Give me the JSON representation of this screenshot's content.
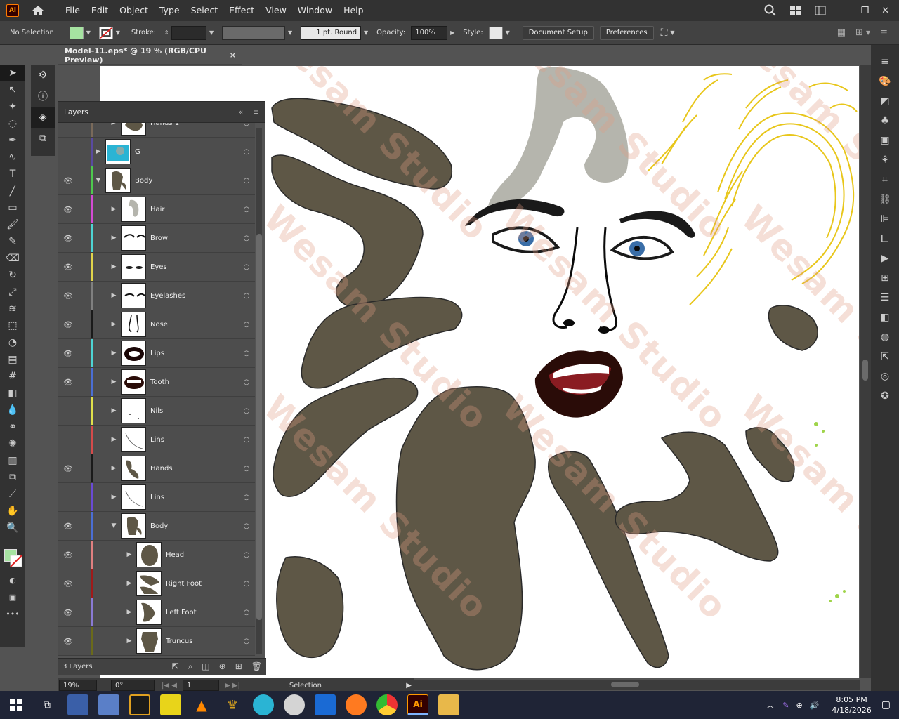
{
  "app": {
    "logo": "Ai"
  },
  "menus": [
    "File",
    "Edit",
    "Object",
    "Type",
    "Select",
    "Effect",
    "View",
    "Window",
    "Help"
  ],
  "control": {
    "selection_state": "No Selection",
    "fill_color": "#a6e3a1",
    "stroke_label": "Stroke:",
    "brush_label": "1 pt. Round",
    "opacity_label": "Opacity:",
    "opacity_value": "100%",
    "style_label": "Style:",
    "document_setup": "Document Setup",
    "preferences": "Preferences"
  },
  "document": {
    "tab_title": "Model-11.eps* @ 19 % (RGB/CPU Preview)",
    "close": "×"
  },
  "layers_panel": {
    "title": "Layers",
    "footer_count": "3 Layers",
    "rows": [
      {
        "name": "Hands 1",
        "eye": false,
        "color": "#7a6a5a",
        "expanded": false,
        "indent": 1
      },
      {
        "name": "G",
        "eye": false,
        "color": "#5a4aa0",
        "expanded": false,
        "indent": 0
      },
      {
        "name": "Body",
        "eye": true,
        "color": "#4ec94e",
        "expanded": true,
        "indent": 0
      },
      {
        "name": "Hair",
        "eye": true,
        "color": "#d44bd4",
        "expanded": false,
        "indent": 1
      },
      {
        "name": "Brow",
        "eye": true,
        "color": "#4ed4d4",
        "expanded": false,
        "indent": 1
      },
      {
        "name": "Eyes",
        "eye": true,
        "color": "#e0d44b",
        "expanded": false,
        "indent": 1
      },
      {
        "name": "Eyelashes",
        "eye": true,
        "color": "#808080",
        "expanded": false,
        "indent": 1
      },
      {
        "name": "Nose",
        "eye": true,
        "color": "#1a1a1a",
        "expanded": false,
        "indent": 1
      },
      {
        "name": "Lips",
        "eye": true,
        "color": "#4ed4d4",
        "expanded": false,
        "indent": 1
      },
      {
        "name": "Tooth",
        "eye": true,
        "color": "#4b6ed4",
        "expanded": false,
        "indent": 1
      },
      {
        "name": "Nils",
        "eye": false,
        "color": "#e0e04b",
        "expanded": false,
        "indent": 1
      },
      {
        "name": "Lins",
        "eye": false,
        "color": "#d44b4b",
        "expanded": false,
        "indent": 1
      },
      {
        "name": "Hands",
        "eye": true,
        "color": "#1a1a1a",
        "expanded": false,
        "indent": 1
      },
      {
        "name": "Lins",
        "eye": false,
        "color": "#6a4ad4",
        "expanded": false,
        "indent": 1
      },
      {
        "name": "Body",
        "eye": true,
        "color": "#4b6ed4",
        "expanded": true,
        "indent": 1
      },
      {
        "name": "Head",
        "eye": true,
        "color": "#e08080",
        "expanded": false,
        "indent": 2
      },
      {
        "name": "Right Foot",
        "eye": true,
        "color": "#a01a1a",
        "expanded": false,
        "indent": 2
      },
      {
        "name": "Left Foot",
        "eye": true,
        "color": "#8a7ad4",
        "expanded": false,
        "indent": 2
      },
      {
        "name": "Truncus",
        "eye": true,
        "color": "#6a6a1a",
        "expanded": false,
        "indent": 2
      }
    ]
  },
  "status": {
    "zoom": "19%",
    "rotation": "0°",
    "artboard": "1",
    "tool": "Selection"
  },
  "watermark": "Wesam Studio",
  "taskbar": {
    "time": "8:05 PM",
    "date": "4/18/2026"
  },
  "colors": {
    "skin": "#5e5746",
    "hair_blonde": "#e8c61a",
    "hair_ghost": "#b5b5ad",
    "lips": "#2a0c08"
  }
}
